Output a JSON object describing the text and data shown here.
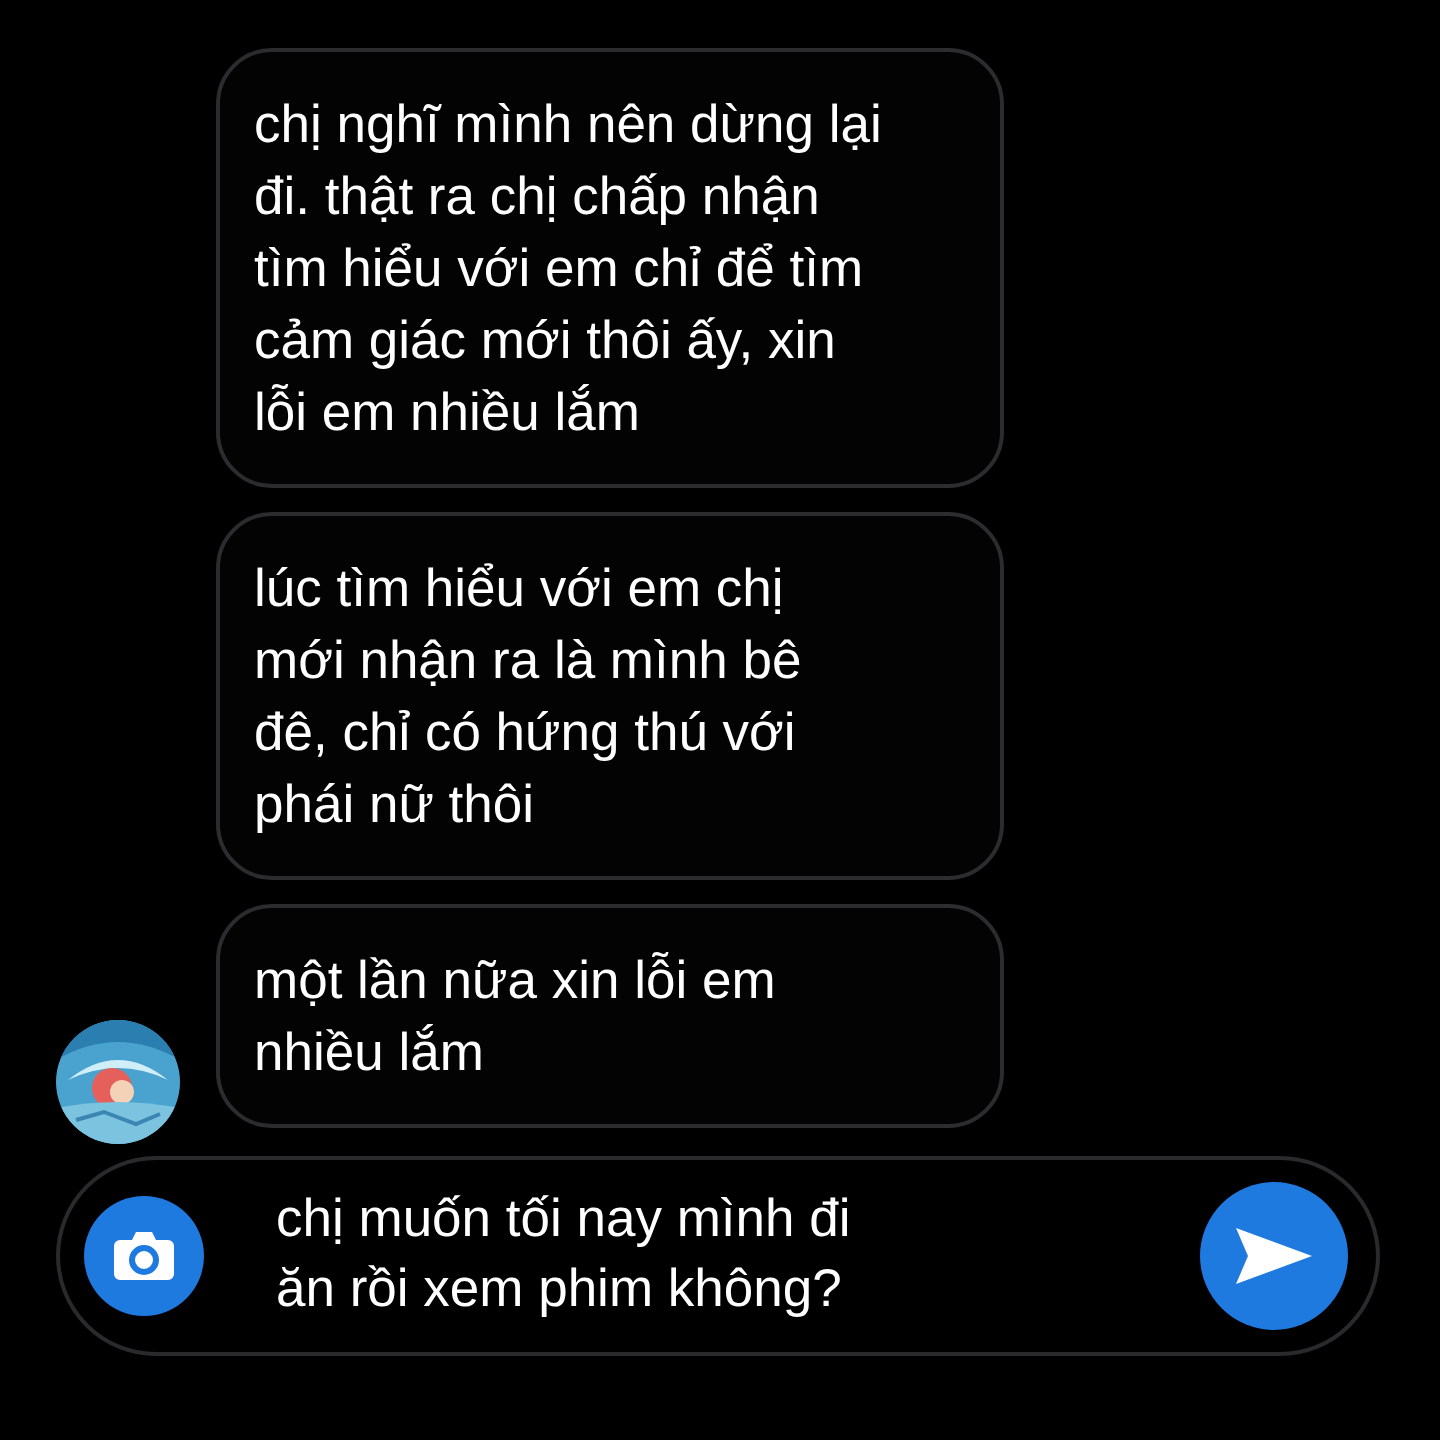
{
  "messages": [
    {
      "text": "chị nghĩ mình nên dừng lại\nđi. thật ra chị chấp nhận\ntìm hiểu với em chỉ để tìm\ncảm giác mới thôi ấy, xin\nlỗi em nhiều lắm",
      "show_avatar": false
    },
    {
      "text": "lúc tìm hiểu với em chị\nmới nhận ra là mình bê\nđê, chỉ có hứng thú với\nphái nữ thôi",
      "show_avatar": false
    },
    {
      "text": "một lần nữa xin lỗi em\nnhiều lắm",
      "show_avatar": true
    }
  ],
  "composer": {
    "value": "chị muốn tối nay mình đi\năn rồi xem phim không?"
  }
}
